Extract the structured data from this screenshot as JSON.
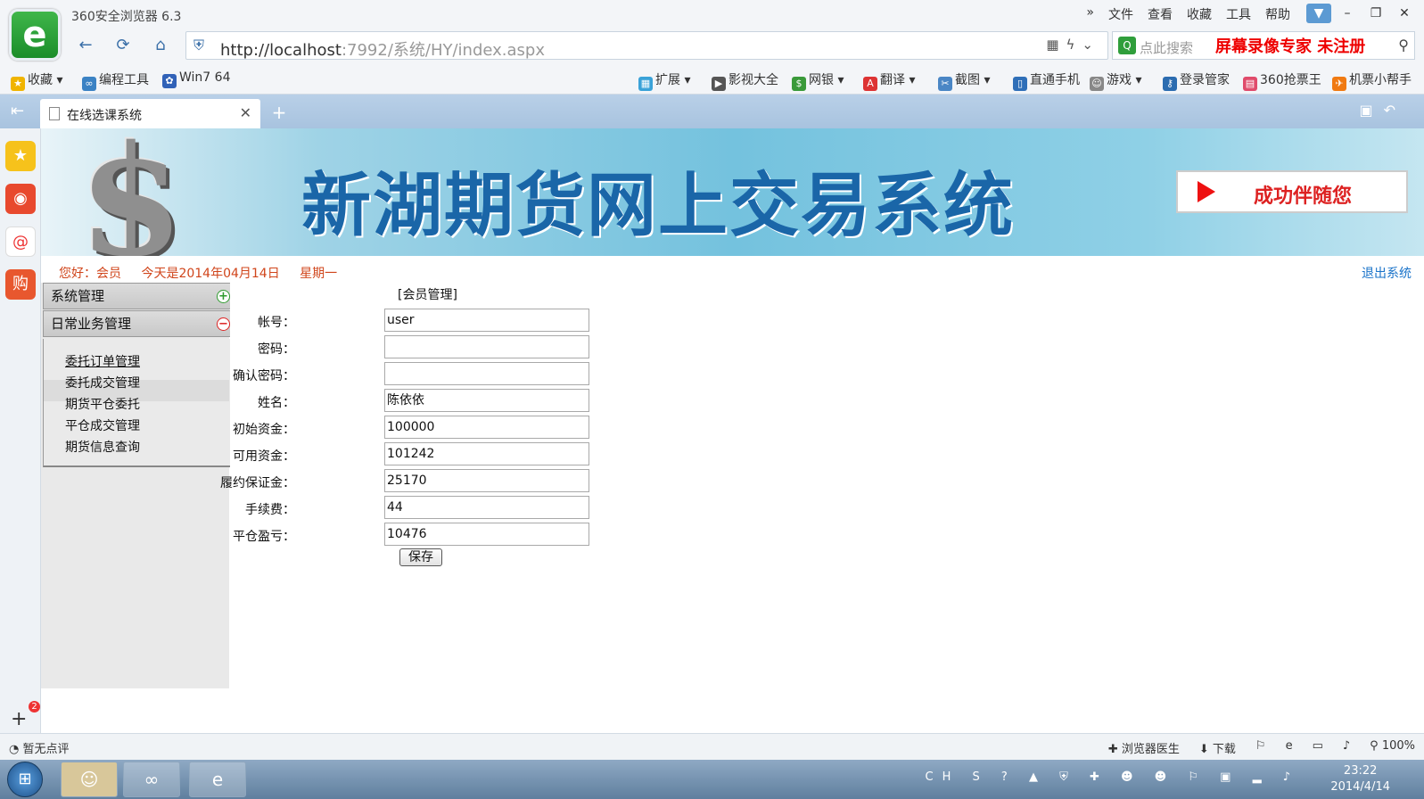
{
  "browser": {
    "title": "360安全浏览器 6.3",
    "menu": [
      "»",
      "文件",
      "查看",
      "收藏",
      "工具",
      "帮助"
    ],
    "url_host": "http://localhost",
    "url_rest": ":7992/系统/HY/index.aspx",
    "search_placeholder": "点此搜索",
    "watermark": "屏幕录像专家  未注册",
    "bookmarks": [
      "收藏",
      "编程工具",
      "Win7 64",
      "扩展",
      "影视大全",
      "网银",
      "翻译",
      "截图",
      "直通手机",
      "游戏",
      "登录管家",
      "360抢票王",
      "机票小帮手"
    ],
    "tab_title": "在线选课系统",
    "status_left": "暂无点评",
    "status_right": [
      "浏览器医生",
      "下载",
      "100%"
    ],
    "sidebar_badge": "2"
  },
  "page": {
    "site_title": "新湖期货网上交易系统",
    "slogan": "成功伴随您",
    "greeting": [
      "您好：会员",
      "今天是2014年04月14日",
      "星期一"
    ],
    "logout": "退出系统",
    "menu": {
      "group1": "系统管理",
      "group2": "日常业务管理",
      "links": [
        "委托订单管理",
        "委托成交管理",
        "期货平仓委托",
        "平仓成交管理",
        "期货信息查询"
      ]
    },
    "form": {
      "section_title": "[会员管理]",
      "fields": [
        {
          "label": "帐号：",
          "value": "user"
        },
        {
          "label": "密码：",
          "value": ""
        },
        {
          "label": "确认密码：",
          "value": ""
        },
        {
          "label": "姓名：",
          "value": "陈依依"
        },
        {
          "label": "初始资金：",
          "value": "100000"
        },
        {
          "label": "可用资金：",
          "value": "101242"
        },
        {
          "label": "履约保证金：",
          "value": "25170"
        },
        {
          "label": "手续费：",
          "value": "44"
        },
        {
          "label": "平仓盈亏：",
          "value": "10476"
        }
      ],
      "save_label": "保存"
    }
  },
  "taskbar": {
    "tray_lang": "CH",
    "time": "23:22",
    "date": "2014/4/14"
  }
}
